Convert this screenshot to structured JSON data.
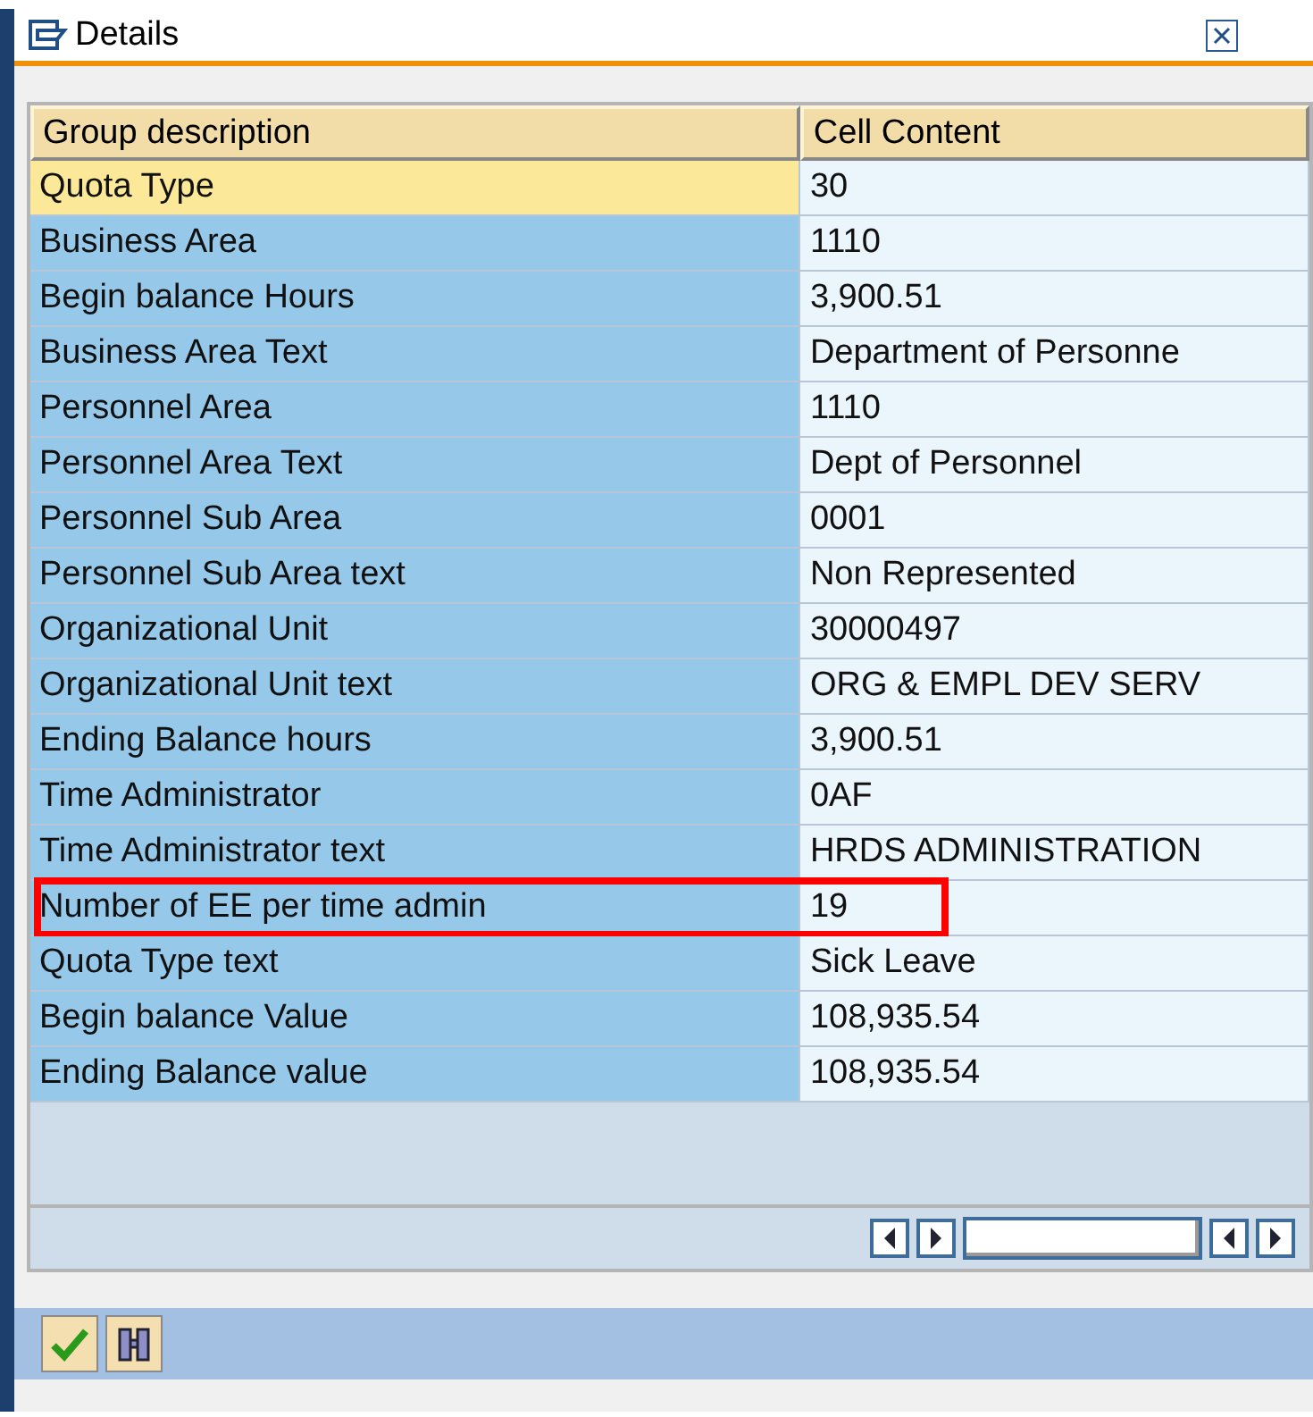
{
  "window": {
    "title": "Details"
  },
  "table": {
    "columns": [
      "Group description",
      "Cell Content"
    ],
    "rows": [
      {
        "cells": [
          "Quota Type",
          "30"
        ],
        "selected": true,
        "highlighted": false
      },
      {
        "cells": [
          "Business Area",
          "1110"
        ],
        "selected": false,
        "highlighted": false
      },
      {
        "cells": [
          "Begin balance Hours",
          "3,900.51"
        ],
        "selected": false,
        "highlighted": false
      },
      {
        "cells": [
          "Business Area Text",
          "Department of Personne"
        ],
        "selected": false,
        "highlighted": false
      },
      {
        "cells": [
          "Personnel Area",
          "1110"
        ],
        "selected": false,
        "highlighted": false
      },
      {
        "cells": [
          "Personnel Area Text",
          "Dept of Personnel"
        ],
        "selected": false,
        "highlighted": false
      },
      {
        "cells": [
          "Personnel Sub Area",
          "0001"
        ],
        "selected": false,
        "highlighted": false
      },
      {
        "cells": [
          "Personnel Sub Area text",
          "Non Represented"
        ],
        "selected": false,
        "highlighted": false
      },
      {
        "cells": [
          "Organizational Unit",
          "30000497"
        ],
        "selected": false,
        "highlighted": false
      },
      {
        "cells": [
          "Organizational Unit text",
          "ORG & EMPL DEV SERV"
        ],
        "selected": false,
        "highlighted": false
      },
      {
        "cells": [
          "Ending Balance hours",
          "3,900.51"
        ],
        "selected": false,
        "highlighted": false
      },
      {
        "cells": [
          "Time Administrator",
          "0AF"
        ],
        "selected": false,
        "highlighted": false
      },
      {
        "cells": [
          "Time Administrator text",
          "HRDS ADMINISTRATION"
        ],
        "selected": false,
        "highlighted": false
      },
      {
        "cells": [
          "Number of EE per time admin",
          "19"
        ],
        "selected": false,
        "highlighted": true
      },
      {
        "cells": [
          "Quota Type text",
          "Sick Leave"
        ],
        "selected": false,
        "highlighted": false
      },
      {
        "cells": [
          "Begin balance Value",
          "108,935.54"
        ],
        "selected": false,
        "highlighted": false
      },
      {
        "cells": [
          "Ending Balance value",
          "108,935.54"
        ],
        "selected": false,
        "highlighted": false
      }
    ]
  }
}
